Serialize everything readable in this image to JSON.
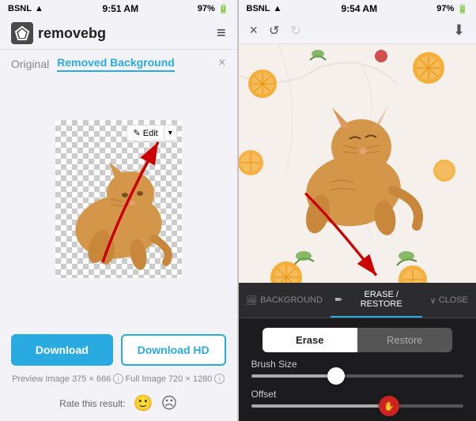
{
  "left": {
    "status": {
      "carrier": "BSNL",
      "wifi": true,
      "time": "9:51 AM",
      "battery": "97%"
    },
    "logo": "removebg",
    "logo_icon": "◈",
    "hamburger": "≡",
    "tabs": {
      "original": "Original",
      "removed": "Removed Background"
    },
    "close_tab": "×",
    "edit_btn": "✎ Edit",
    "edit_arrow": "▾",
    "download_btn": "Download",
    "download_hd_btn": "Download HD",
    "preview_label": "Preview Image",
    "preview_size": "375 × 666",
    "full_label": "Full Image",
    "full_size": "720 × 1280",
    "info_icon": "ⓘ",
    "rating_label": "Rate this result:",
    "emoji_happy": "🙂",
    "emoji_sad": "☹"
  },
  "right": {
    "status": {
      "carrier": "BSNL",
      "wifi": true,
      "time": "9:54 AM",
      "battery": "97%"
    },
    "nav": {
      "close": "×",
      "undo": "↺",
      "redo": "↻",
      "download": "⬇"
    },
    "toolbar": {
      "tabs": [
        {
          "label": "BACKGROUND",
          "icon": "🖼",
          "active": false
        },
        {
          "label": "ERASE / RESTORE",
          "icon": "✏",
          "active": true
        }
      ],
      "close": "∨ CLOSE"
    },
    "erase_btn": "Erase",
    "restore_btn": "Restore",
    "brush_size_label": "Brush Size",
    "offset_label": "Offset",
    "brush_thumb_pct": 40,
    "offset_thumb_pct": 65
  }
}
